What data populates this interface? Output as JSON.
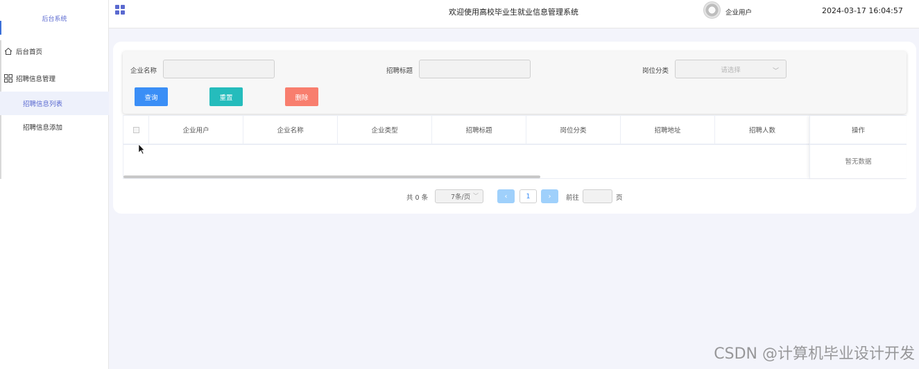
{
  "sidebar": {
    "title": "后台系统",
    "home": "后台首页",
    "group": "招聘信息管理",
    "items": [
      {
        "label": "招聘信息列表"
      },
      {
        "label": "招聘信息添加"
      }
    ]
  },
  "topbar": {
    "system_title": "欢迎使用高校毕业生就业信息管理系统",
    "user_name": "企业用户",
    "datetime": "2024-03-17 16:04:57"
  },
  "search": {
    "company_label": "企业名称",
    "title_label": "招聘标题",
    "category_label": "岗位分类",
    "category_placeholder": "请选择",
    "query_button": "查询",
    "reset_button": "重置",
    "delete_button": "删除"
  },
  "table": {
    "columns": [
      "企业用户",
      "企业名称",
      "企业类型",
      "招聘标题",
      "岗位分类",
      "招聘地址",
      "招聘人数"
    ],
    "action_column": "操作",
    "empty_text": "暂无数据"
  },
  "pagination": {
    "total_text": "共 0 条",
    "page_size": "7条/页",
    "current_page": "1",
    "goto_label": "前往",
    "page_word": "页"
  },
  "watermark": "CSDN @计算机毕业设计开发",
  "colors": {
    "accent": "#5b6ad0",
    "query": "#3a8ef6",
    "reset": "#25bcbc",
    "delete": "#f87e6e"
  }
}
